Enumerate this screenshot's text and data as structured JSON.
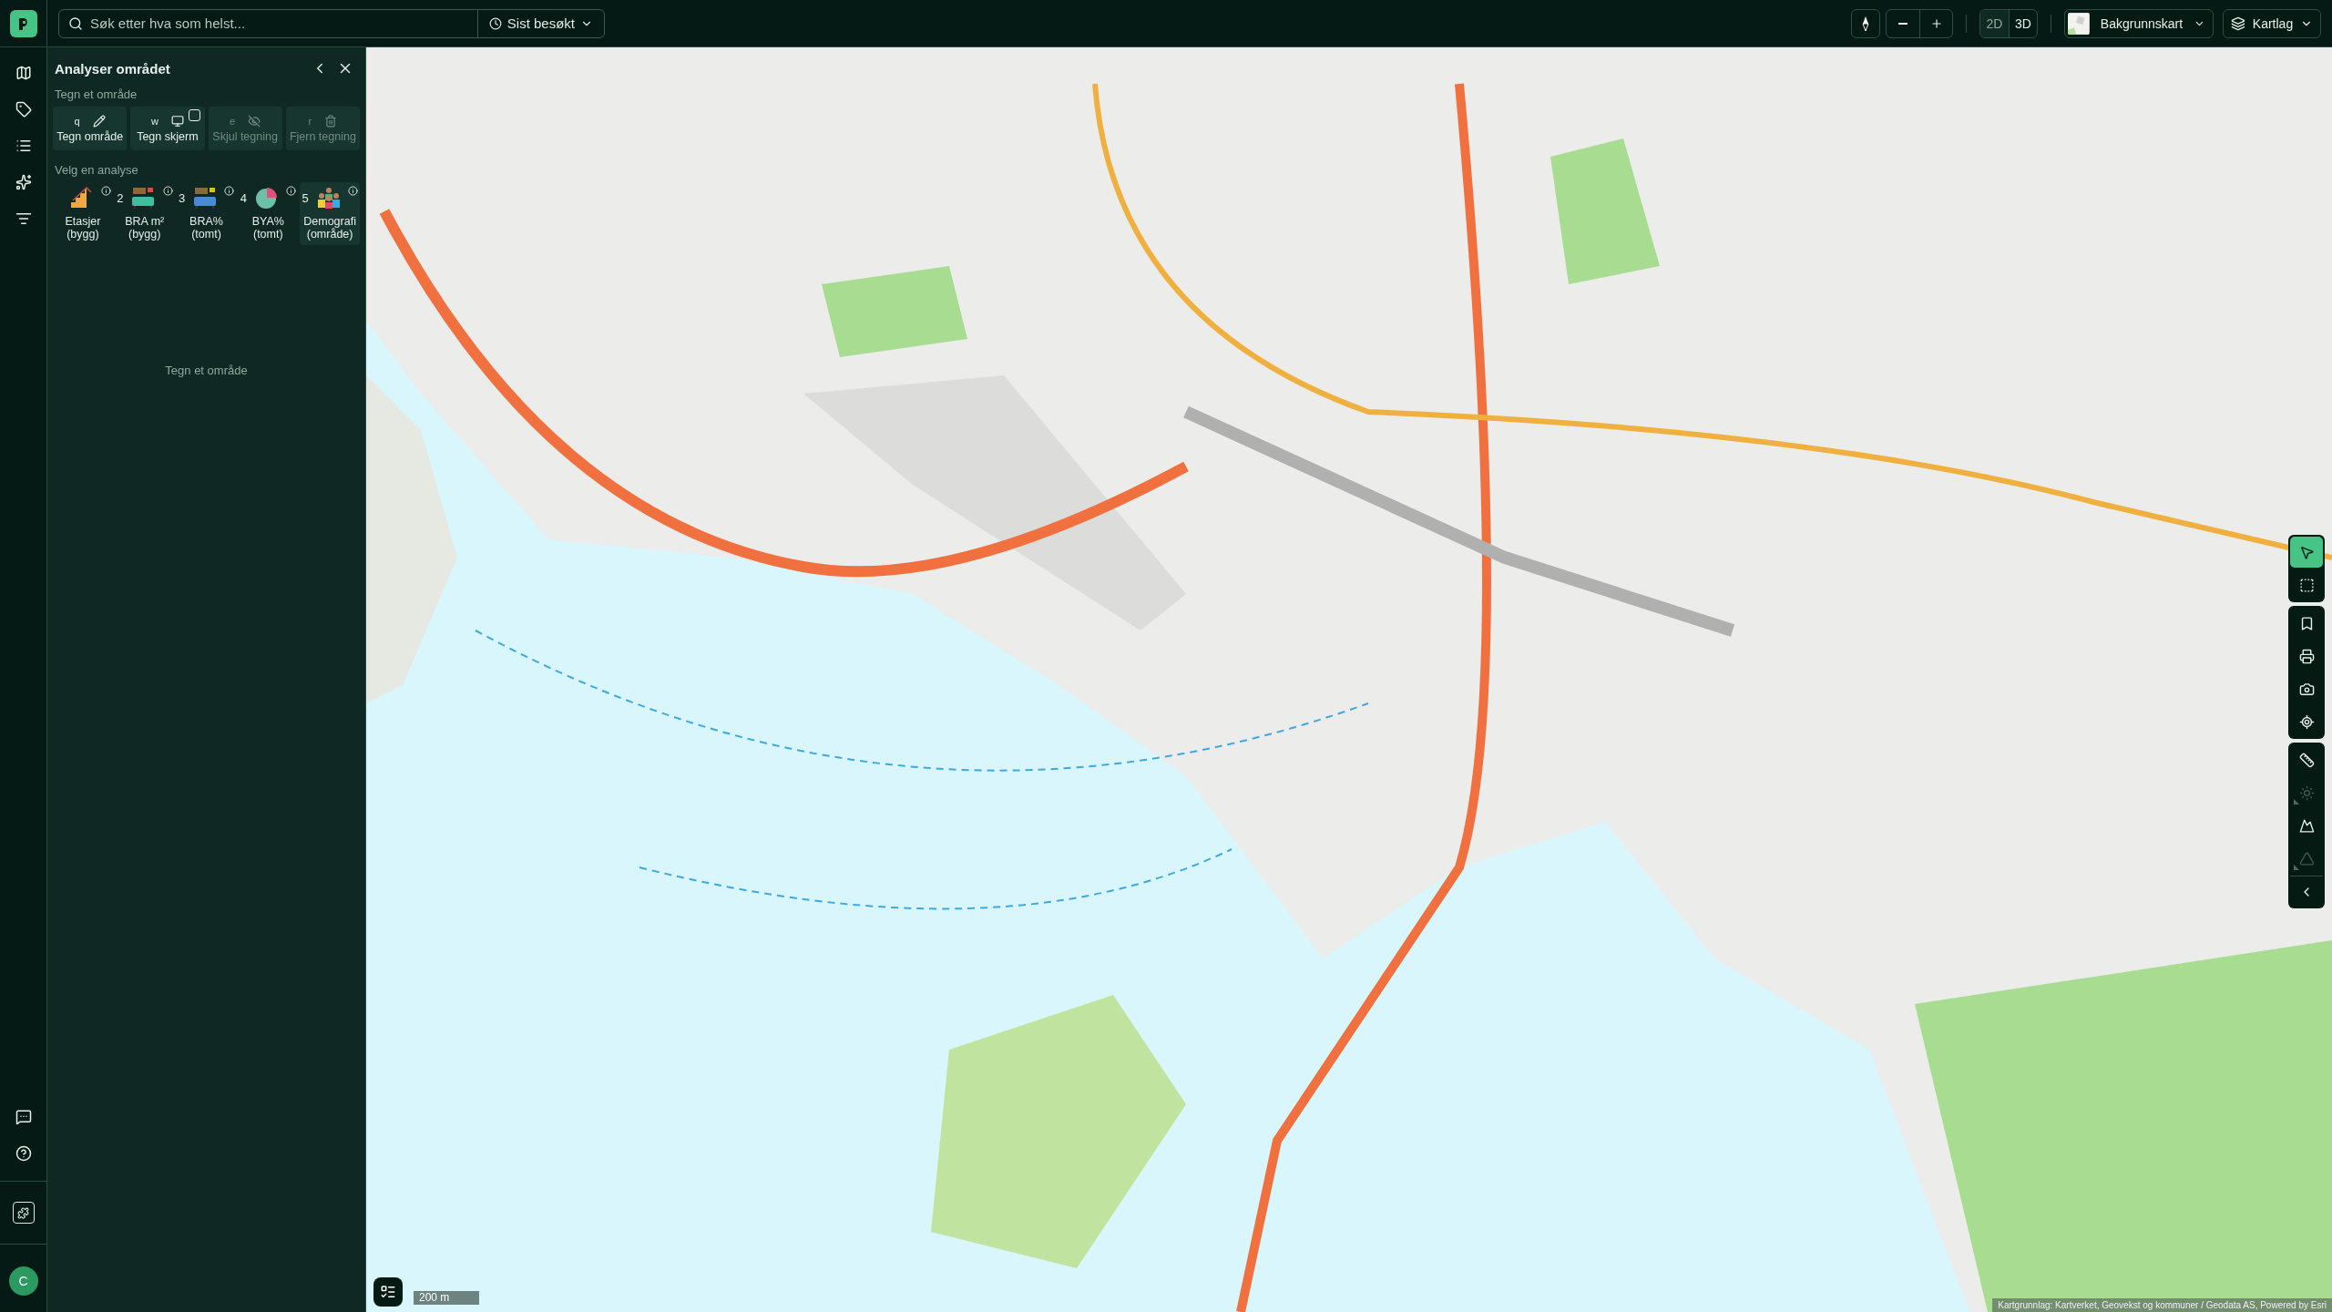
{
  "topbar": {
    "search": {
      "placeholder": "Søk etter hva som helst..."
    },
    "recent": "Sist besøkt",
    "view_modes": [
      {
        "label": "2D",
        "selected": true
      },
      {
        "label": "3D",
        "selected": false
      }
    ],
    "basemap": "Bakgrunnskart",
    "layers": "Kartlag"
  },
  "rail": {
    "items": [
      {
        "kind": "map"
      },
      {
        "kind": "tag"
      },
      {
        "kind": "list"
      },
      {
        "kind": "sparkles"
      },
      {
        "kind": "filter"
      }
    ],
    "bottom_items": [
      {
        "kind": "chat"
      },
      {
        "kind": "help"
      }
    ],
    "avatar": "C"
  },
  "panel": {
    "title": "Analyser området",
    "draw_section": "Tegn et område",
    "draw_tools": [
      {
        "key": "q",
        "label": "Tegn område",
        "kind": "pencil",
        "disabled": false
      },
      {
        "key": "w",
        "label": "Tegn skjerm",
        "kind": "screen",
        "disabled": false,
        "checked": false
      },
      {
        "key": "e",
        "label": "Skjul tegning",
        "kind": "hide",
        "disabled": true
      },
      {
        "key": "r",
        "label": "Fjern tegning",
        "kind": "trash",
        "disabled": true
      }
    ],
    "analysis_section": "Velg en analyse",
    "analyses": [
      {
        "label": "Etasjer",
        "sub": "(bygg)",
        "kind": "stairs",
        "selected": false
      },
      {
        "number": "2",
        "label": "BRA m²",
        "sub": "(bygg)",
        "kind": "sofa",
        "selected": false
      },
      {
        "number": "3",
        "label": "BRA%",
        "sub": "(tomt)",
        "kind": "sofa-blue",
        "selected": false
      },
      {
        "number": "4",
        "label": "BYA%",
        "sub": "(tomt)",
        "kind": "pie",
        "selected": false
      },
      {
        "number": "5",
        "label": "Demografi",
        "sub": "(område)",
        "kind": "people",
        "selected": true
      }
    ],
    "empty_message": "Tegn et område"
  },
  "map": {
    "kind": "picture",
    "tool_groups": [
      {
        "items": [
          {
            "kind": "pointer",
            "selected": true,
            "disabled": false
          },
          {
            "kind": "select-area",
            "selected": false,
            "disabled": false
          }
        ]
      },
      {
        "items": [
          {
            "kind": "bookmark",
            "selected": false,
            "disabled": false
          },
          {
            "kind": "print",
            "selected": false,
            "disabled": false
          },
          {
            "kind": "camera",
            "selected": false,
            "disabled": false
          },
          {
            "kind": "locate",
            "selected": false,
            "disabled": false
          }
        ]
      },
      {
        "items": [
          {
            "kind": "measure",
            "selected": false,
            "disabled": false
          },
          {
            "kind": "sun",
            "selected": false,
            "disabled": true
          },
          {
            "kind": "terrain",
            "selected": false,
            "disabled": false
          },
          {
            "kind": "viewshed",
            "selected": false,
            "disabled": true
          }
        ]
      }
    ],
    "scale": "200 m",
    "attribution": "Kartgrunnlag: Kartverket, Geovekst og kommuner / Geodata AS, Powered by Esri"
  }
}
